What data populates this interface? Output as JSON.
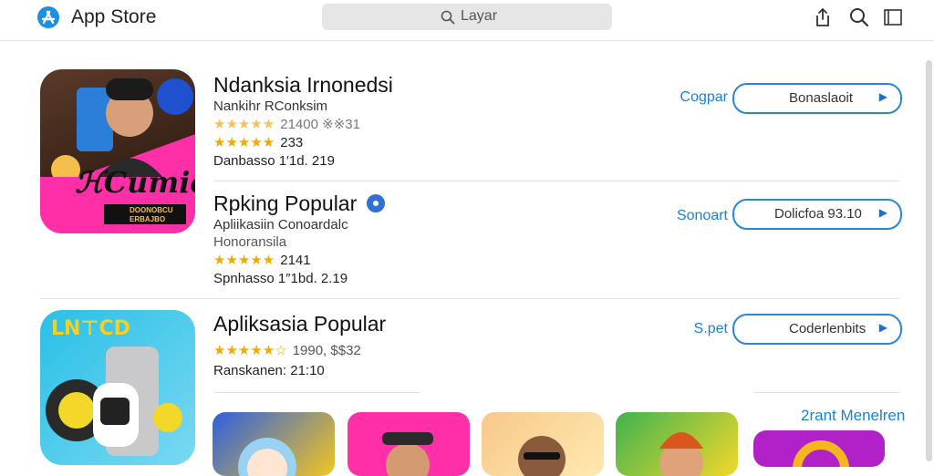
{
  "header": {
    "app_title": "App Store",
    "logo_icon": "app-store-icon",
    "search_placeholder": "Layar",
    "icons": [
      "share-icon",
      "search-icon",
      "sidebar-icon"
    ]
  },
  "rows": [
    {
      "title": "Ndanksia Irnonedsi",
      "subtitle": "Nankihr RConksim",
      "stars_top": "★★★★★",
      "stars_top_text": "21400 ※※31",
      "rating_stars": "★★★★★",
      "rating_value": "233",
      "meta": "Danbasso 1′1d. 219",
      "action_label": "Cogpar",
      "button_label": "Bonaslaoit",
      "thumb_text": "ℋCumicu",
      "thumb_sub": "DOONOBCU ERBAJBO"
    },
    {
      "title": "Rpking Popular",
      "badge_icon": "verified-badge-icon",
      "subtitle": "Apliikasiin Conoardalc",
      "subtitle2": "Honoransila",
      "rating_stars": "★★★★★",
      "rating_value": "2141",
      "meta": "Spnhasso 1″1bd. 2.19",
      "action_label": "Sonoart",
      "button_label": "Dolicfoa 93.10"
    },
    {
      "title": "Apliksasia Popular",
      "rating_stars": "★★★★★☆",
      "rating_value": "1990, $$32",
      "meta": "Ranskanen: 21:10",
      "action_label": "S.pet",
      "button_label": "Coderlenbits",
      "thumb_text": "LN⊤CD"
    }
  ],
  "see_all": "2rant Menelren",
  "colors": {
    "accent": "#1c7fd6",
    "star": "#f2a900",
    "pink": "#ff2fa8",
    "search_bg": "#e6e6e6"
  }
}
